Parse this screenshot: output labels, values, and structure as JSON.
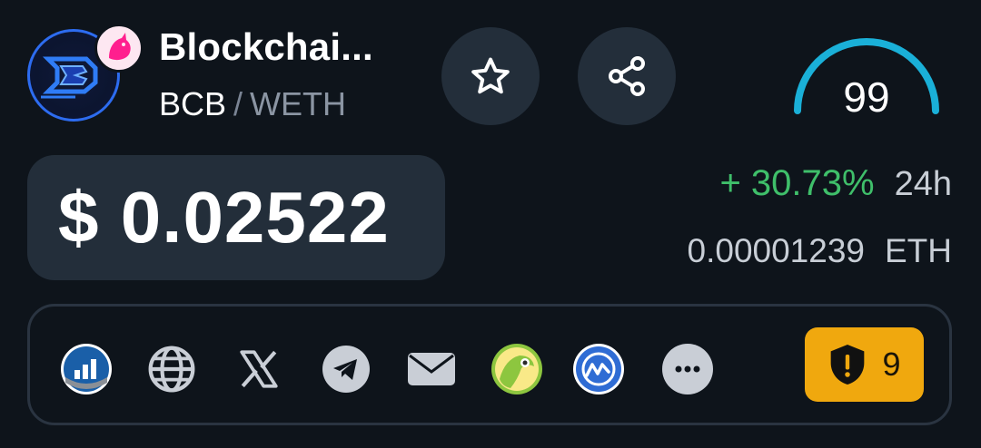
{
  "token": {
    "name": "Blockchai...",
    "base_symbol": "BCB",
    "separator": "/",
    "quote_symbol": "WETH",
    "logo_icon": "bcb-logo",
    "dex_icon": "uniswap-unicorn-icon"
  },
  "actions": {
    "favorite_icon": "star-icon",
    "share_icon": "share-icon"
  },
  "score": {
    "value": "99",
    "fraction": 0.99,
    "color": "#1ab0d8"
  },
  "price": {
    "usd": "$ 0.02522",
    "change": "+ 30.73%",
    "change_period": "24h",
    "change_color": "#3fbf6a",
    "native_value": "0.00001239",
    "native_symbol": "ETH"
  },
  "links": [
    {
      "icon": "chart-site-icon"
    },
    {
      "icon": "globe-icon"
    },
    {
      "icon": "x-twitter-icon"
    },
    {
      "icon": "telegram-icon"
    },
    {
      "icon": "mail-icon"
    },
    {
      "icon": "coingecko-icon"
    },
    {
      "icon": "coinmarketcap-icon"
    },
    {
      "icon": "more-icon"
    }
  ],
  "audit": {
    "icon": "shield-alert-icon",
    "count": "9",
    "color": "#f0a80e"
  }
}
